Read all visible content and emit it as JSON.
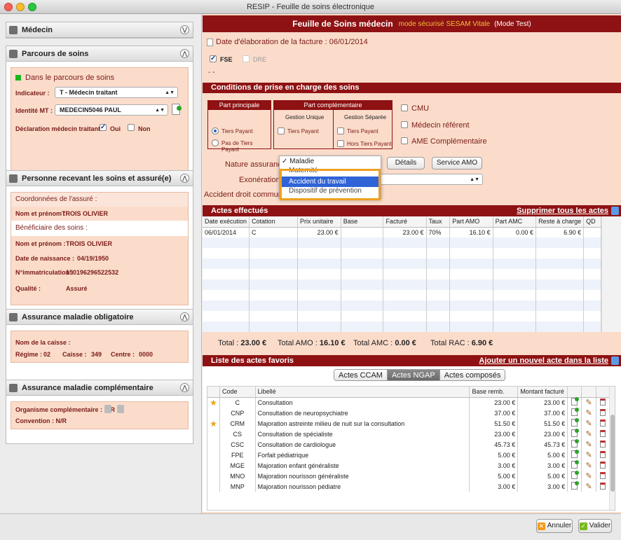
{
  "window": {
    "title": "RESIP - Feuille de soins électronique"
  },
  "left": {
    "medecin": {
      "title": "Médecin"
    },
    "parcours": {
      "title": "Parcours de soins",
      "status": "Dans le parcours de soins",
      "indicateur_label": "Indicateur :",
      "indicateur_value": "T - Médecin traitant",
      "identite_label": "Identité MT :",
      "identite_value": "MEDECIN5046 PAUL",
      "declaration_label": "Déclaration médecin traitant :",
      "oui": "Oui",
      "non": "Non"
    },
    "personne": {
      "title": "Personne recevant les soins et assuré(e)",
      "coord_title": "Coordonnées de l'assuré :",
      "nom_label": "Nom et prénom :",
      "nom_value": "TROIS OLIVIER",
      "benef_title": "Bénéficiaire des soins :",
      "benef_nom_label": "Nom et prénom :",
      "benef_nom_value": "TROIS OLIVIER",
      "naissance_label": "Date de naissance :",
      "naissance_value": "04/19/1950",
      "immat_label": "N°immatriculation :",
      "immat_value": "150196296522532",
      "qualite_label": "Qualité :",
      "qualite_value": "Assuré"
    },
    "amo": {
      "title": "Assurance maladie obligatoire",
      "caisse_label": "Nom de la caisse :",
      "regime_label": "Régime :",
      "regime_value": "02",
      "caisse2_label": "Caisse :",
      "caisse2_value": "349",
      "centre_label": "Centre :",
      "centre_value": "0000"
    },
    "amc": {
      "title": "Assurance maladie complémentaire",
      "organisme": "Organisme complémentaire : N/R",
      "convention": "Convention : N/R"
    }
  },
  "right": {
    "title": "Feuille de Soins médecin",
    "mode": "mode sécurisé SESAM Vitale",
    "test": "(Mode Test)",
    "date_facture": "Date d'élaboration de la facture : 06/01/2014",
    "fse": "FSE",
    "dre": "DRE",
    "dashes": "- -",
    "conditions_title": "Conditions de prise en charge des soins",
    "part_principale": "Part principale",
    "part_complementaire": "Part complémentaire",
    "gestion_unique": "Gestion Unique",
    "gestion_separee": "Gestion Séparée",
    "tiers_payant": "Tiers Payant",
    "pas_tiers_payant": "Pas de Tiers Payant",
    "tiers_payant_gu": "Tiers Payant",
    "tiers_payant_gs": "Tiers Payant",
    "hors_tiers_payant": "Hors Tiers Payant",
    "cmu": "CMU",
    "medecin_referent": "Médecin référent",
    "ame": "AME Complémentaire",
    "nature_label": "Nature assurance",
    "exoneration_label": "Exonération",
    "accident_label": "Accident droit commun",
    "details_btn": "Détails",
    "service_amo_btn": "Service AMO",
    "dropdown": {
      "options": [
        "Maladie",
        "Maternité",
        "Accident du travail",
        "Dispositif de prévention"
      ],
      "checked": "✓"
    },
    "actes_title": "Actes effectués",
    "supprimer_link": "Supprimer tous les actes",
    "actes_cols": [
      "Date exécution",
      "Cotation",
      "Prix unitaire",
      "Base",
      "Facturé",
      "Taux",
      "Part AMO",
      "Part AMC",
      "Reste à charge",
      "QD"
    ],
    "actes_rows": [
      [
        "06/01/2014",
        "C",
        "23.00 €",
        "",
        "23.00 €",
        "70%",
        "16.10 €",
        "0.00 €",
        "6.90 €",
        ""
      ]
    ],
    "totals": {
      "total_label": "Total :",
      "total_value": "23.00 €",
      "amo_label": "Total AMO :",
      "amo_value": "16.10 €",
      "amc_label": "Total AMC :",
      "amc_value": "0.00 €",
      "rac_label": "Total RAC :",
      "rac_value": "6.90 €"
    },
    "favoris_title": "Liste des actes favoris",
    "ajouter_link": "Ajouter un nouvel acte dans la liste",
    "tabs": [
      "Actes CCAM",
      "Actes NGAP",
      "Actes composés"
    ],
    "fav_cols": [
      "Code",
      "Libellé",
      "Base remb.",
      "Montant facturé"
    ],
    "fav_rows": [
      {
        "star": true,
        "code": "C",
        "libelle": "Consultation",
        "base": "23.00 €",
        "montant": "23.00 €"
      },
      {
        "star": false,
        "code": "CNP",
        "libelle": "Consultation de neuropsychiatre",
        "base": "37.00 €",
        "montant": "37.00 €"
      },
      {
        "star": true,
        "code": "CRM",
        "libelle": "Majoration astreinte milieu de nuit sur la consultation",
        "base": "51.50 €",
        "montant": "51.50 €"
      },
      {
        "star": false,
        "code": "CS",
        "libelle": "Consultation de spécialiste",
        "base": "23.00 €",
        "montant": "23.00 €"
      },
      {
        "star": false,
        "code": "CSC",
        "libelle": "Consultation de cardiologue",
        "base": "45.73 €",
        "montant": "45.73 €"
      },
      {
        "star": false,
        "code": "FPE",
        "libelle": "Forfait pédiatrique",
        "base": "5.00 €",
        "montant": "5.00 €"
      },
      {
        "star": false,
        "code": "MGE",
        "libelle": "Majoration enfant généraliste",
        "base": "3.00 €",
        "montant": "3.00 €"
      },
      {
        "star": false,
        "code": "MNO",
        "libelle": "Majoration nourisson généraliste",
        "base": "5.00 €",
        "montant": "5.00 €"
      },
      {
        "star": false,
        "code": "MNP",
        "libelle": "Majoration nourisson pédiatre",
        "base": "3.00 €",
        "montant": "3.00 €"
      }
    ]
  },
  "footer": {
    "annuler": "Annuler",
    "valider": "Valider"
  },
  "colors": {
    "maroon": "#8e1213",
    "salmon": "#fbdccb",
    "highlight": "#f0a020",
    "selection": "#2f63d6"
  }
}
